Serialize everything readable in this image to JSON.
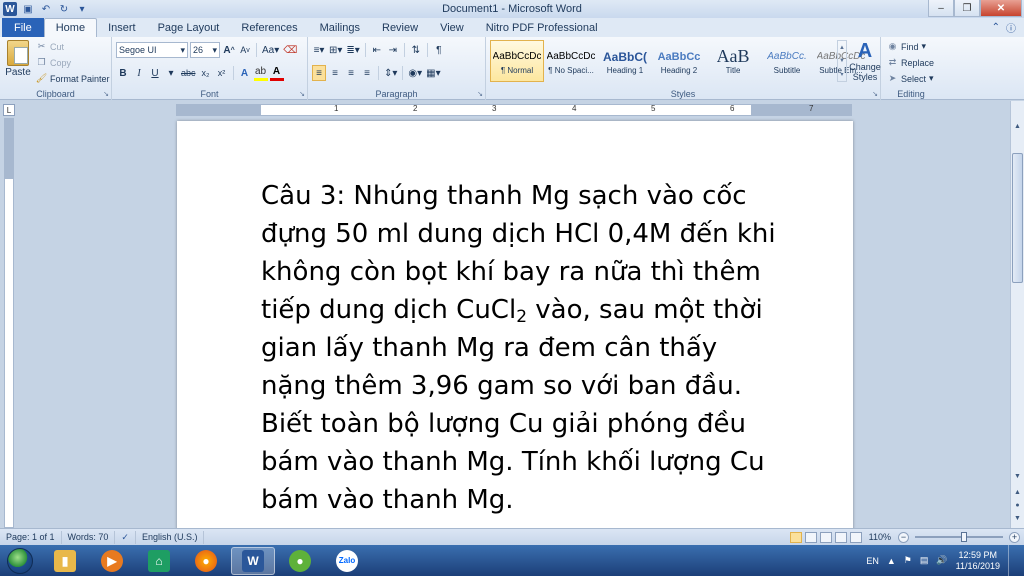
{
  "window": {
    "title": "Document1 - Microsoft Word"
  },
  "tabs": [
    "File",
    "Home",
    "Insert",
    "Page Layout",
    "References",
    "Mailings",
    "Review",
    "View",
    "Nitro PDF Professional"
  ],
  "clipboard": {
    "paste": "Paste",
    "cut": "Cut",
    "copy": "Copy",
    "format_painter": "Format Painter",
    "label": "Clipboard"
  },
  "font": {
    "family": "Segoe UI",
    "size": "26",
    "label": "Font",
    "grow": "A",
    "shrink": "A",
    "change_case": "Aa",
    "bold": "B",
    "italic": "I",
    "underline": "U",
    "strikethrough": "abc",
    "subscript": "x₂",
    "superscript": "x²"
  },
  "paragraph": {
    "label": "Paragraph"
  },
  "styles": {
    "label": "Styles",
    "items": [
      {
        "preview": "AaBbCcDc",
        "name": "¶ Normal"
      },
      {
        "preview": "AaBbCcDc",
        "name": "¶ No Spaci..."
      },
      {
        "preview": "AaBbC(",
        "name": "Heading 1"
      },
      {
        "preview": "AaBbCc",
        "name": "Heading 2"
      },
      {
        "preview": "AaB",
        "name": "Title"
      },
      {
        "preview": "AaBbCc.",
        "name": "Subtitle"
      },
      {
        "preview": "AaBbCcDc",
        "name": "Subtle Em..."
      }
    ],
    "change_styles": "Change Styles"
  },
  "editing": {
    "label": "Editing",
    "find": "Find",
    "replace": "Replace",
    "select": "Select"
  },
  "ruler": {
    "tab_selector": "L",
    "numbers": [
      "1",
      "2",
      "3",
      "4",
      "5",
      "6",
      "7"
    ]
  },
  "document": {
    "lines": [
      "Câu 3: Nhúng thanh Mg sạch vào cốc",
      "đựng 50 ml dung dịch HCl 0,4M đến khi",
      "không còn bọt khí bay ra nữa thì thêm",
      "tiếp dung dịch CuCl",
      "gian lấy thanh Mg ra đem cân thấy",
      "nặng thêm 3,96 gam so với ban đầu.",
      "Biết toàn bộ lượng Cu giải phóng đều",
      "bám vào thanh Mg. Tính khối lượng Cu",
      "bám vào thanh Mg."
    ],
    "line4_sub": "2",
    "line4_rest": " vào, sau một thời"
  },
  "status": {
    "page": "Page: 1 of 1",
    "words": "Words: 70",
    "language": "English (U.S.)",
    "zoom": "110%"
  },
  "taskbar": {
    "lang": "EN",
    "time": "12:59 PM",
    "date": "11/16/2019",
    "zalo": "Zalo"
  },
  "colors": {
    "file_tab": "#2a63b8",
    "word_blue": "#2b579a",
    "taskbar": "#1c3f78"
  }
}
